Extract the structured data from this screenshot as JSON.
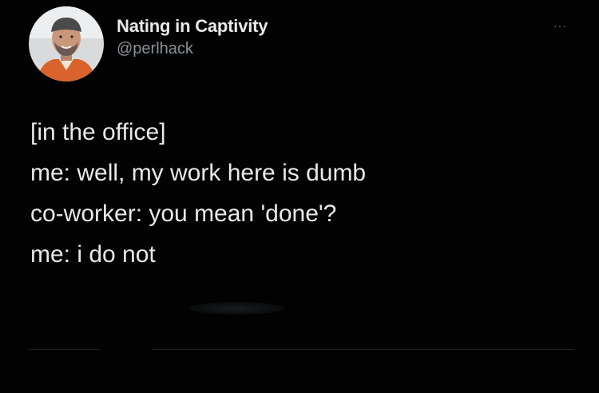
{
  "tweet": {
    "display_name": "Nating in Captivity",
    "handle": "@perlhack",
    "more_label": "···",
    "lines": [
      "[in the office]",
      "me: well, my work here is dumb",
      "co-worker: you mean 'done'?",
      "me: i do not"
    ]
  },
  "colors": {
    "background": "#020202",
    "text": "#e7e9ea",
    "secondary_text": "#8b9096",
    "avatar_shirt": "#d9632b"
  }
}
